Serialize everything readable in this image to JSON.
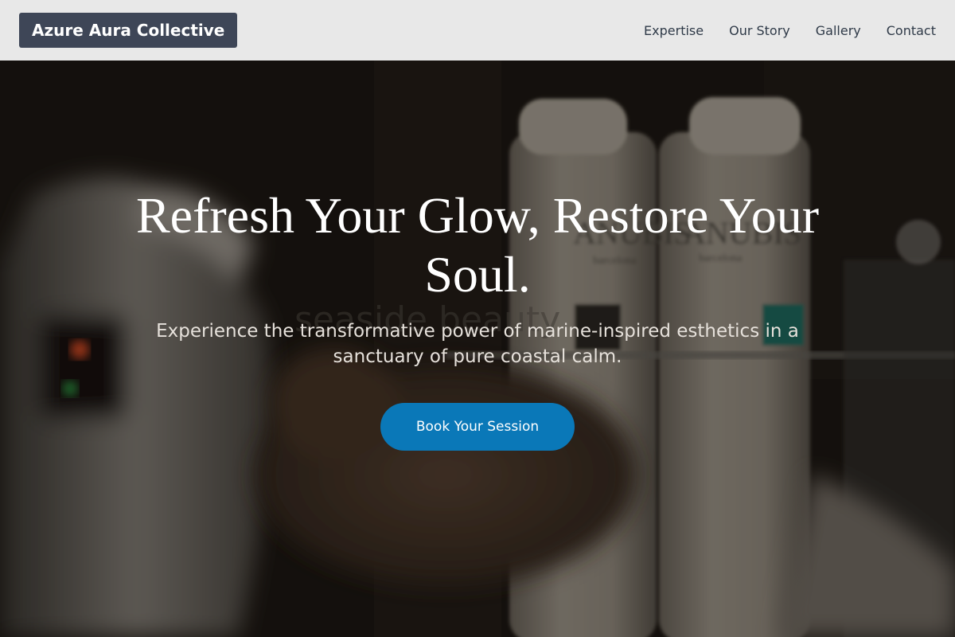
{
  "header": {
    "brand": "Azure Aura Collective",
    "nav": [
      {
        "label": "Expertise"
      },
      {
        "label": "Our Story"
      },
      {
        "label": "Gallery"
      },
      {
        "label": "Contact"
      }
    ]
  },
  "hero": {
    "title": "Refresh Your Glow, Restore Your Soul.",
    "subtitle": "Experience the transformative power of marine-inspired esthetics in a sanctuary of pure coastal calm.",
    "cta_label": "Book Your Session",
    "photo_text": {
      "bottle_brand": "ANUBIS",
      "bottle_city": "barcelona",
      "watermark": "seaside beauty"
    }
  },
  "colors": {
    "header_bg": "#e8e8e8",
    "brand_bg": "#3e4657",
    "cta_bg": "#0a78b8"
  }
}
